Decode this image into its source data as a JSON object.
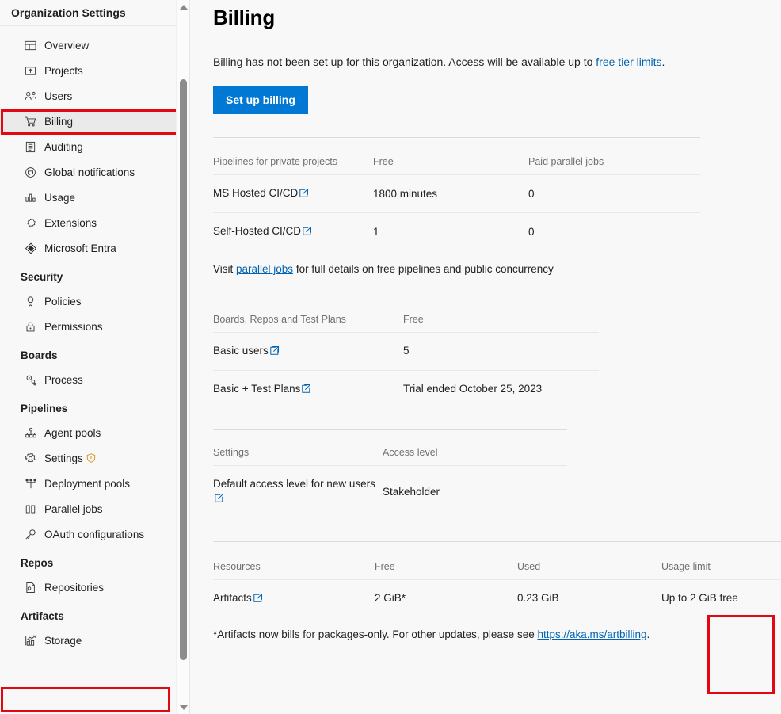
{
  "sidebar": {
    "header": "Organization Settings",
    "items": [
      {
        "label": "Overview",
        "icon": "overview-icon",
        "type": "item",
        "selected": false
      },
      {
        "label": "Projects",
        "icon": "projects-icon",
        "type": "item",
        "selected": false
      },
      {
        "label": "Users",
        "icon": "users-icon",
        "type": "item",
        "selected": false
      },
      {
        "label": "Billing",
        "icon": "billing-cart-icon",
        "type": "item",
        "selected": true
      },
      {
        "label": "Auditing",
        "icon": "auditing-icon",
        "type": "item",
        "selected": false
      },
      {
        "label": "Global notifications",
        "icon": "notifications-icon",
        "type": "item",
        "selected": false
      },
      {
        "label": "Usage",
        "icon": "usage-chart-icon",
        "type": "item",
        "selected": false
      },
      {
        "label": "Extensions",
        "icon": "extensions-icon",
        "type": "item",
        "selected": false
      },
      {
        "label": "Microsoft Entra",
        "icon": "microsoft-entra-icon",
        "type": "item",
        "selected": false
      },
      {
        "label": "Security",
        "type": "group"
      },
      {
        "label": "Policies",
        "icon": "policies-icon",
        "type": "item",
        "selected": false
      },
      {
        "label": "Permissions",
        "icon": "permissions-lock-icon",
        "type": "item",
        "selected": false
      },
      {
        "label": "Boards",
        "type": "group"
      },
      {
        "label": "Process",
        "icon": "process-icon",
        "type": "item",
        "selected": false
      },
      {
        "label": "Pipelines",
        "type": "group"
      },
      {
        "label": "Agent pools",
        "icon": "agent-pools-icon",
        "type": "item",
        "selected": false
      },
      {
        "label": "Settings",
        "icon": "gear-icon",
        "type": "item",
        "selected": false,
        "badge": "warning-shield-icon"
      },
      {
        "label": "Deployment pools",
        "icon": "deployment-pools-icon",
        "type": "item",
        "selected": false
      },
      {
        "label": "Parallel jobs",
        "icon": "parallel-jobs-icon",
        "type": "item",
        "selected": false
      },
      {
        "label": "OAuth configurations",
        "icon": "oauth-key-icon",
        "type": "item",
        "selected": false
      },
      {
        "label": "Repos",
        "type": "group"
      },
      {
        "label": "Repositories",
        "icon": "repositories-icon",
        "type": "item",
        "selected": false
      },
      {
        "label": "Artifacts",
        "type": "group"
      },
      {
        "label": "Storage",
        "icon": "storage-chart-icon",
        "type": "item",
        "selected": false
      }
    ]
  },
  "main": {
    "title": "Billing",
    "intro": {
      "before": "Billing has not been set up for this organization. Access will be available up to ",
      "link": "free tier limits",
      "after": "."
    },
    "setup_button": "Set up billing",
    "pipelines_table": {
      "headers": [
        "Pipelines for private projects",
        "Free",
        "Paid parallel jobs"
      ],
      "rows": [
        {
          "name": "MS Hosted CI/CD",
          "external": true,
          "free": "1800 minutes",
          "paid": "0"
        },
        {
          "name": "Self-Hosted CI/CD",
          "external": true,
          "free": "1",
          "paid": "0"
        }
      ],
      "note": {
        "before": "Visit ",
        "link": "parallel jobs",
        "after": " for full details on free pipelines and public concurrency"
      }
    },
    "boards_table": {
      "headers": [
        "Boards, Repos and Test Plans",
        "Free"
      ],
      "rows": [
        {
          "name": "Basic users",
          "external": true,
          "free": "5"
        },
        {
          "name": "Basic + Test Plans",
          "external": true,
          "free": "Trial ended October 25, 2023"
        }
      ]
    },
    "settings_table": {
      "headers": [
        "Settings",
        "Access level"
      ],
      "rows": [
        {
          "name": "Default access level for new users",
          "external": true,
          "value": "Stakeholder"
        }
      ]
    },
    "resources_table": {
      "headers": [
        "Resources",
        "Free",
        "Used",
        "Usage limit"
      ],
      "rows": [
        {
          "name": "Artifacts",
          "external": true,
          "free": "2 GiB*",
          "used": "0.23 GiB",
          "limit": "Up to 2 GiB free"
        }
      ],
      "note": {
        "before": "*Artifacts now bills for packages-only. For other updates, please see ",
        "link": "https://aka.ms/artbilling",
        "after": "."
      }
    }
  },
  "colors": {
    "accent": "#0078d4",
    "link": "#0063b1",
    "annotation": "#e30613",
    "selected_bg": "#eaeaea",
    "page_bg": "#f8f8f8",
    "warning": "#d18f17"
  }
}
